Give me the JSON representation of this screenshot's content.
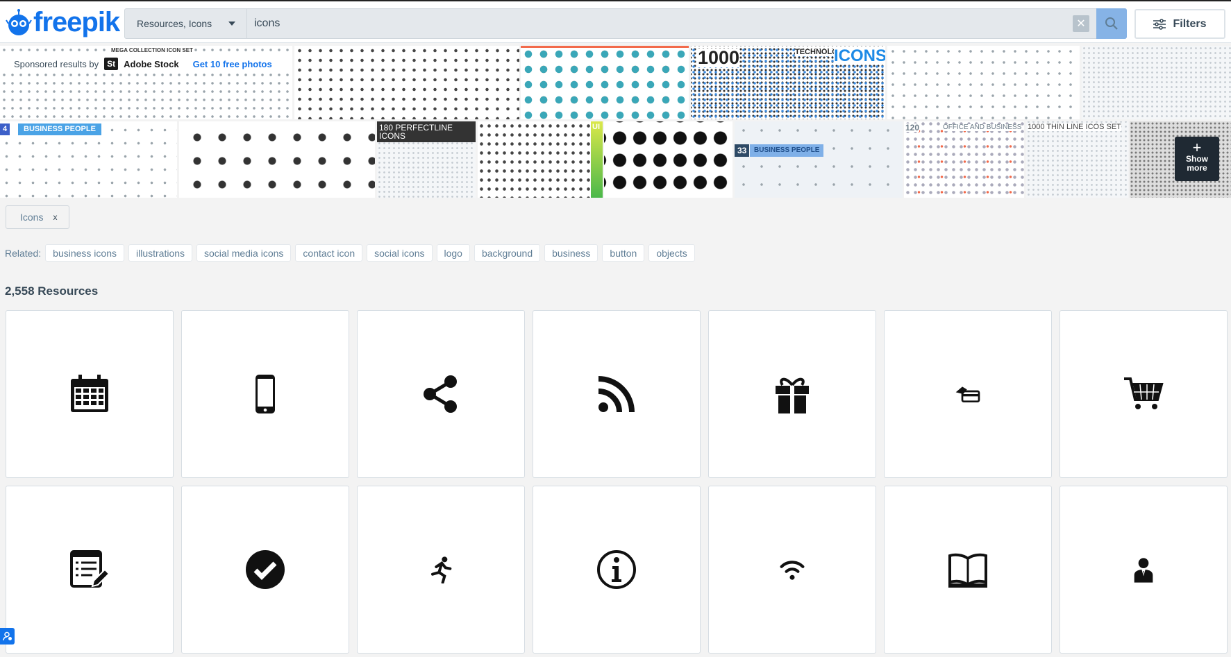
{
  "header": {
    "logo": "freepik",
    "search": {
      "scope": "Resources, Icons",
      "query": "icons",
      "clear_icon": "close-icon",
      "search_icon": "search-icon"
    },
    "filters_label": "Filters"
  },
  "sponsored": {
    "label": "Sponsored results by",
    "brand_badge": "St",
    "brand": "Adobe Stock",
    "cta": "Get 10 free photos",
    "thumbs_text": {
      "mega": "MEGA COLLECTION ICON SET",
      "thousand": "1000",
      "icons": "ICONS",
      "technology": "TECHNOLOGY",
      "bp_num": "4",
      "business_people": "BUSINESS PEOPLE",
      "perfectline": "180 PERFECTLINE ICONS",
      "ui": "UI",
      "bp33_num": "33",
      "bp33": "BUSINESS PEOPLE",
      "office_num": "120",
      "office": "OFFICE AND BUSINESS",
      "thinline": "1000 THIN LINE ICOS SET"
    },
    "show_more": "Show more"
  },
  "active_filter": {
    "label": "Icons",
    "remove": "x"
  },
  "related": {
    "label": "Related:",
    "tags": [
      "business icons",
      "illustrations",
      "social media icons",
      "contact icon",
      "social icons",
      "logo",
      "background",
      "business",
      "button",
      "objects"
    ]
  },
  "results": {
    "count": "2,558 Resources",
    "items": [
      "calendar-icon",
      "smartphone-icon",
      "share-icon",
      "rss-icon",
      "gift-icon",
      "card-payment-icon",
      "shopping-cart-icon",
      "edit-form-icon",
      "check-circle-icon",
      "runner-icon",
      "info-icon",
      "wifi-icon",
      "open-book-icon",
      "businessman-icon"
    ]
  },
  "colors": {
    "brand": "#1273eb",
    "search_button": "#86b3e6",
    "background": "#f3f3f3"
  }
}
